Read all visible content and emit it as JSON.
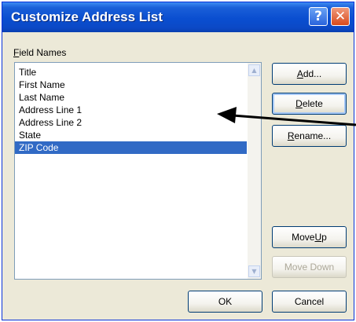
{
  "window": {
    "title": "Customize Address List",
    "help_glyph": "?",
    "close_glyph": "✕"
  },
  "field_names": {
    "label_accel": "F",
    "label_rest": "ield Names",
    "items": [
      {
        "label": "Title",
        "selected": false
      },
      {
        "label": "First Name",
        "selected": false
      },
      {
        "label": "Last Name",
        "selected": false
      },
      {
        "label": "Address Line 1",
        "selected": false
      },
      {
        "label": "Address Line 2",
        "selected": false
      },
      {
        "label": "State",
        "selected": false
      },
      {
        "label": "ZIP Code",
        "selected": true
      }
    ]
  },
  "buttons": {
    "add": {
      "accel": "A",
      "rest": "dd..."
    },
    "delete": {
      "accel": "D",
      "rest": "elete"
    },
    "rename": {
      "accel": "R",
      "rest": "ename..."
    },
    "move_up": {
      "pre": "Move ",
      "accel": "U",
      "rest": "p"
    },
    "move_down": {
      "label": "Move Down",
      "enabled": false
    },
    "ok": "OK",
    "cancel": "Cancel"
  },
  "icons": {
    "scroll_up": "up-arrow",
    "scroll_down": "down-arrow",
    "annotation": "callout-arrow"
  },
  "colors": {
    "title_bar": "#0a4ed0",
    "selection": "#316ac5",
    "close_button": "#d84a1c"
  }
}
